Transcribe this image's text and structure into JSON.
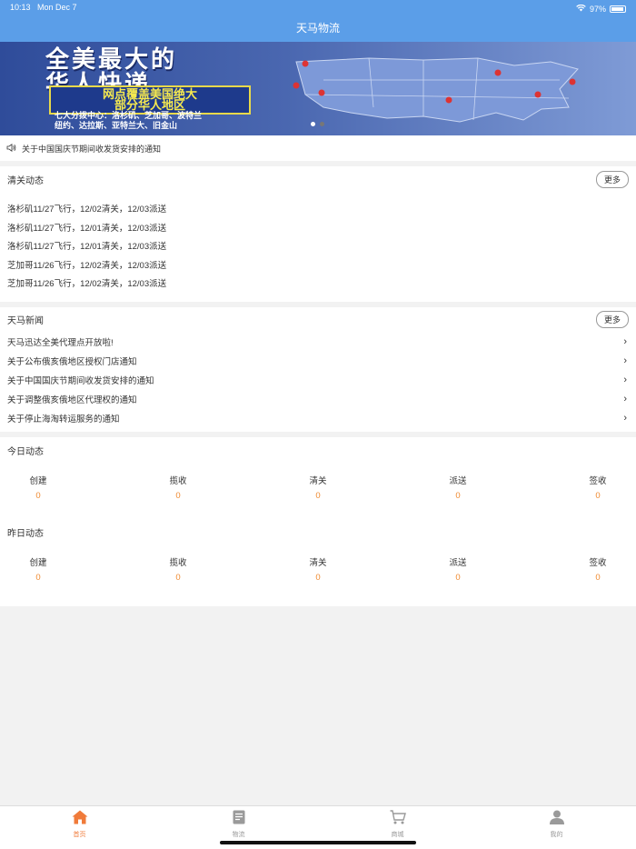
{
  "status": {
    "time": "10:13",
    "date": "Mon Dec 7",
    "battery": "97%"
  },
  "header": {
    "title": "天马物流"
  },
  "banner": {
    "headline": [
      "全美最大的",
      "华人快递"
    ],
    "subtitle": [
      "网点覆盖美国绝大",
      "部分华人地区"
    ],
    "centers": [
      "七大分拨中心：洛杉矶、芝加哥、波特兰",
      "纽约、达拉斯、亚特兰大、旧金山"
    ]
  },
  "notice": {
    "text": "关于中国国庆节期间收发货安排的通知"
  },
  "clearance": {
    "title": "清关动态",
    "more": "更多",
    "items": [
      "洛杉矶11/27飞行，12/02清关，12/03派送",
      "洛杉矶11/27飞行，12/01清关，12/03派送",
      "洛杉矶11/27飞行，12/01清关，12/03派送",
      "芝加哥11/26飞行，12/02清关，12/03派送",
      "芝加哥11/26飞行，12/02清关，12/03派送"
    ]
  },
  "news": {
    "title": "天马新闻",
    "more": "更多",
    "items": [
      "天马迅达全美代理点开放啦!",
      "关于公布俄亥俄地区授权门店通知",
      "关于中国国庆节期间收发货安排的通知",
      "关于调整俄亥俄地区代理权的通知",
      "关于停止海淘转运服务的通知"
    ]
  },
  "today": {
    "title": "今日动态",
    "stats": [
      {
        "label": "创建",
        "value": "0"
      },
      {
        "label": "揽收",
        "value": "0"
      },
      {
        "label": "清关",
        "value": "0"
      },
      {
        "label": "派送",
        "value": "0"
      },
      {
        "label": "签收",
        "value": "0"
      }
    ]
  },
  "yesterday": {
    "title": "昨日动态",
    "stats": [
      {
        "label": "创建",
        "value": "0"
      },
      {
        "label": "揽收",
        "value": "0"
      },
      {
        "label": "清关",
        "value": "0"
      },
      {
        "label": "派送",
        "value": "0"
      },
      {
        "label": "签收",
        "value": "0"
      }
    ]
  },
  "tabbar": {
    "items": [
      {
        "label": "首页",
        "icon": "home-icon"
      },
      {
        "label": "物流",
        "icon": "document-icon"
      },
      {
        "label": "商城",
        "icon": "cart-icon"
      },
      {
        "label": "我的",
        "icon": "user-icon"
      }
    ],
    "active_color": "#f07b3a",
    "inactive_color": "#999999"
  }
}
